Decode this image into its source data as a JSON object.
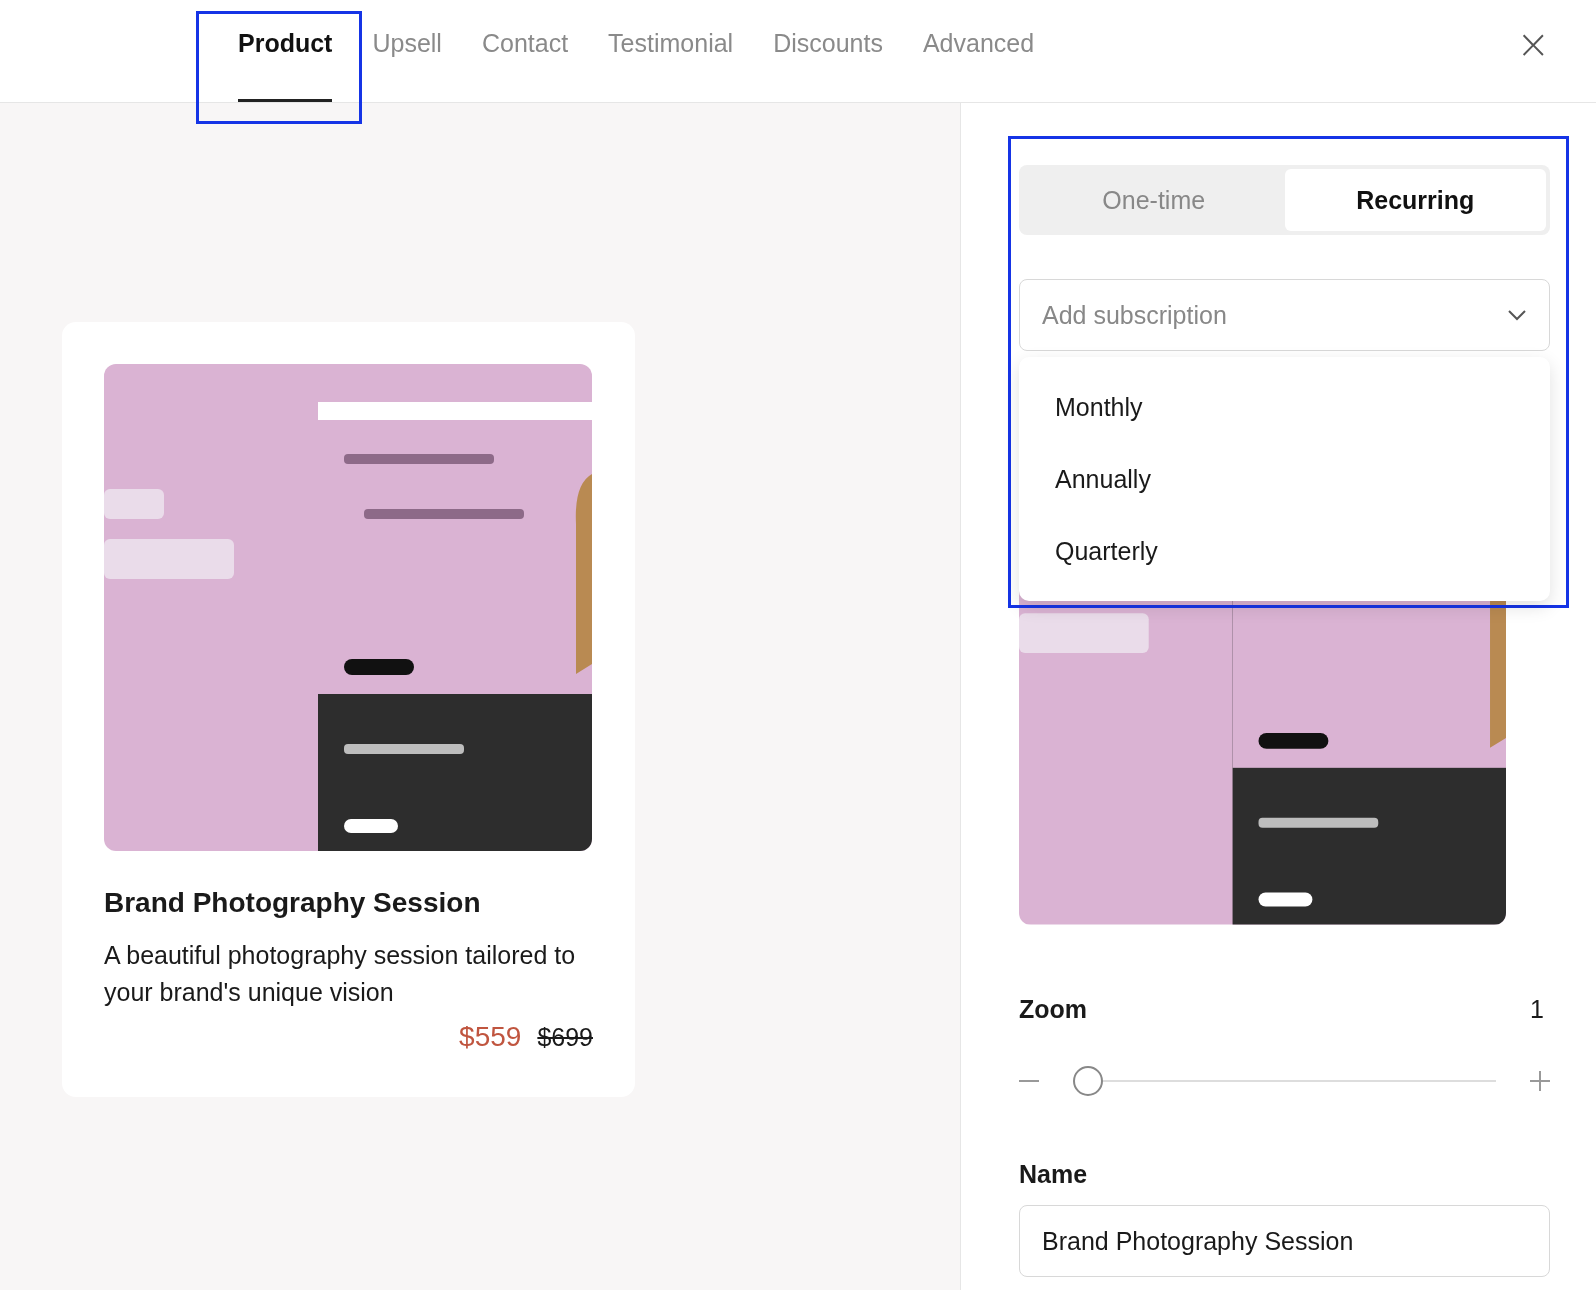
{
  "tabs": [
    {
      "label": "Product",
      "selected": true,
      "highlighted": true
    },
    {
      "label": "Upsell",
      "selected": false,
      "highlighted": false
    },
    {
      "label": "Contact",
      "selected": false,
      "highlighted": false
    },
    {
      "label": "Testimonial",
      "selected": false,
      "highlighted": false
    },
    {
      "label": "Discounts",
      "selected": false,
      "highlighted": false
    },
    {
      "label": "Advanced",
      "selected": false,
      "highlighted": false
    }
  ],
  "close_symbol": "×",
  "product_card": {
    "title": "Brand Photography Session",
    "description": "A beautiful photography session tailored to your brand's unique vision",
    "price": "$559",
    "old_price": "$699"
  },
  "billing": {
    "highlighted": true,
    "options": [
      {
        "label": "One-time",
        "selected": false
      },
      {
        "label": "Recurring",
        "selected": true
      }
    ]
  },
  "subscription_select": {
    "placeholder": "Add subscription",
    "expanded": true,
    "options": [
      {
        "label": "Monthly"
      },
      {
        "label": "Annually"
      },
      {
        "label": "Quarterly"
      }
    ]
  },
  "zoom": {
    "label": "Zoom",
    "value": "1",
    "level": 0
  },
  "name_field": {
    "label": "Name",
    "value": "Brand Photography Session"
  }
}
